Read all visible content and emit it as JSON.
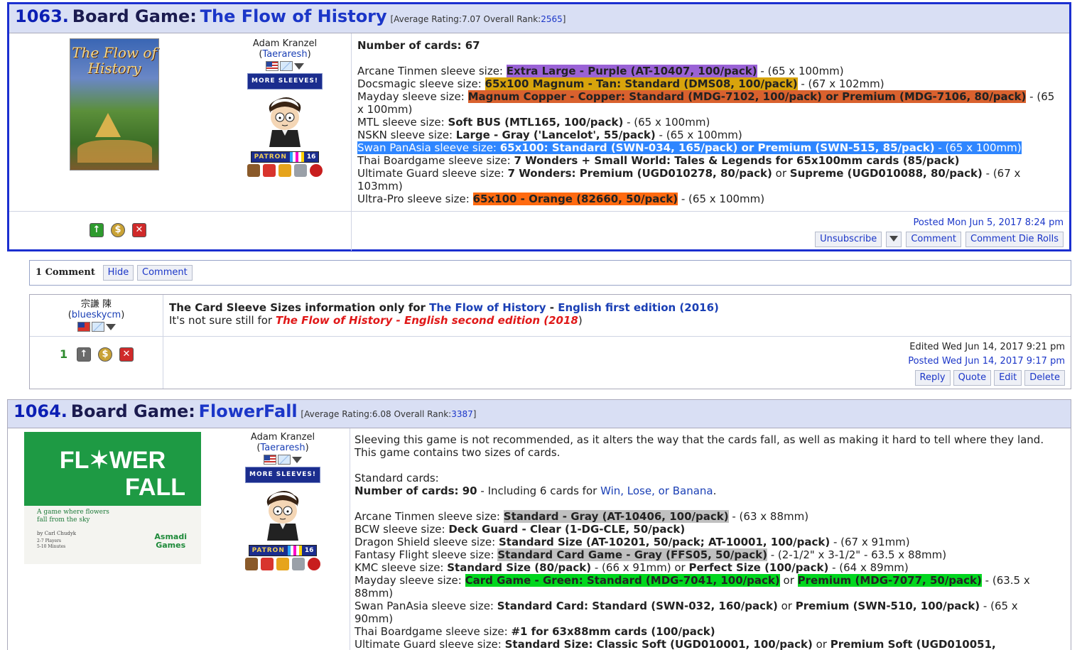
{
  "post1": {
    "number": "1063.",
    "kind": "Board Game:",
    "name": "The Flow of History",
    "meta_prefix": "[Average Rating:7.07 Overall Rank:",
    "rank": "2565",
    "meta_suffix": "]",
    "cover_title": "The Flow of History",
    "user": {
      "name": "Adam Kranzel",
      "handle_open": "(",
      "handle": "Taeraresh",
      "handle_close": ")",
      "more_sleeves": "MORE SLEEVES!",
      "patron": "PATRON",
      "patron_num": "16"
    },
    "lines": [
      {
        "label": "Number of cards: ",
        "value": "67"
      },
      {
        "label": "Arcane Tinmen sleeve size: ",
        "value": "Extra Large - Purple (AT-10407, 100/pack)",
        "after": " - (65 x 100mm)",
        "hl": "purple"
      },
      {
        "label": "Docsmagic sleeve size: ",
        "value": "65x100 Magnum - Tan: Standard (DMS08, 100/pack)",
        "after": " - (67 x 102mm)",
        "hl": "gold"
      },
      {
        "label": "Mayday sleeve size: ",
        "value": "Magnum Copper - Copper: Standard (MDG-7102, 100/pack) or Premium (MDG-7106, 80/pack)",
        "after": " - (65",
        "hl": "copper"
      },
      {
        "label": "",
        "value": "",
        "after": "x 100mm)"
      },
      {
        "label": "MTL sleeve size: ",
        "value": "Soft BUS (MTL165, 100/pack)",
        "after": " - (65 x 100mm)"
      },
      {
        "label": "NSKN sleeve size: ",
        "value": "Large - Gray ('Lancelot', 55/pack)",
        "after": " - (65 x 100mm)"
      },
      {
        "label": "Swan PanAsia sleeve size: ",
        "value": "65x100: Standard (SWN-034, 165/pack) or Premium (SWN-515, 85/pack)",
        "after": " - (65 x 100mm)",
        "hl": "blue"
      },
      {
        "label": "Thai Boardgame sleeve size: ",
        "value": "7 Wonders + Small World: Tales & Legends for 65x100mm cards (85/pack)",
        "after": ""
      },
      {
        "label": "Ultimate Guard sleeve size: ",
        "value": "7 Wonders: Premium (UGD010278, 80/pack)",
        "mid": " or ",
        "value2": "Supreme (UGD010088, 80/pack)",
        "after": " - (67 x"
      },
      {
        "label": "",
        "value": "",
        "after": "103mm)"
      },
      {
        "label": "Ultra-Pro sleeve size: ",
        "value": "65x100 - Orange (82660, 50/pack)",
        "after": " - (65 x 100mm)",
        "hl": "orange"
      }
    ],
    "posted": "Posted Mon Jun 5, 2017 8:24 pm",
    "buttons": {
      "unsubscribe": "Unsubscribe",
      "comment": "Comment",
      "die_rolls": "Comment Die Rolls"
    }
  },
  "comments_bar": {
    "count": "1 Comment",
    "hide": "Hide",
    "comment": "Comment"
  },
  "comment": {
    "user_name": "宗謙 陳",
    "handle_open": "(",
    "handle": "blueskycm",
    "handle_close": ")",
    "score": "1",
    "line1_prefix": "The Card Sleeve Sizes information only for ",
    "line1_link": "The Flow of History",
    "line1_sep": " - ",
    "line1_edition": "English first edition (2016)",
    "line2_prefix": "It's not sure still for ",
    "line2_red": "The Flow of History - English second edition (2018",
    "line2_suffix": ")",
    "edited": "Edited Wed Jun 14, 2017 9:21 pm",
    "posted": "Posted Wed Jun 14, 2017 9:17 pm",
    "buttons": {
      "reply": "Reply",
      "quote": "Quote",
      "edit": "Edit",
      "delete": "Delete"
    }
  },
  "post2": {
    "number": "1064.",
    "kind": "Board Game:",
    "name": "FlowerFall",
    "meta_prefix": "[Average Rating:6.08 Overall Rank:",
    "rank": "3387",
    "meta_suffix": "]",
    "cover": {
      "title1": "FL✶WER",
      "title2": "FALL",
      "tagline": "A game where flowers fall from the sky",
      "author": "by Carl Chudyk",
      "players": "2-7 Players",
      "time": "5-10 Minutes",
      "publisher1": "Asmadi",
      "publisher2": "Games"
    },
    "user": {
      "name": "Adam Kranzel",
      "handle_open": "(",
      "handle": "Taeraresh",
      "handle_close": ")",
      "more_sleeves": "MORE SLEEVES!",
      "patron": "PATRON",
      "patron_num": "16"
    },
    "intro1": "Sleeving this game is not recommended, as it alters the way that the cards fall, as well as making it hard to tell where they land.",
    "intro2": "This game contains two sizes of cards.",
    "standard": "Standard cards:",
    "count_label": "Number of cards: 90",
    "count_after": " - Including 6 cards for ",
    "count_link": "Win, Lose, or Banana",
    "count_end": ".",
    "lines": [
      {
        "label": "Arcane Tinmen sleeve size: ",
        "value": "Standard - Gray (AT-10406, 100/pack)",
        "after": " - (63 x 88mm)",
        "hl": "gray"
      },
      {
        "label": "BCW sleeve size: ",
        "value": "Deck Guard - Clear (1-DG-CLE, 50/pack)",
        "after": ""
      },
      {
        "label": "Dragon Shield sleeve size: ",
        "value": "Standard Size (AT-10201, 50/pack; AT-10001, 100/pack)",
        "after": " - (67 x 91mm)"
      },
      {
        "label": "Fantasy Flight sleeve size: ",
        "value": "Standard Card Game - Gray (FFS05, 50/pack)",
        "after": " - (2-1/2\" x 3-1/2\" - 63.5 x 88mm)",
        "hl": "gray"
      },
      {
        "label": "KMC sleeve size: ",
        "value": "Standard Size (80/pack)",
        "mid": " - (66 x 91mm) or ",
        "value2": "Perfect Size (100/pack)",
        "after": " - (64 x 89mm)"
      },
      {
        "label": "Mayday sleeve size: ",
        "value": "Card Game - Green: Standard (MDG-7041, 100/pack)",
        "mid": " or ",
        "value2": "Premium (MDG-7077, 50/pack)",
        "after": " - (63.5 x",
        "hl": "green",
        "hl2": "green"
      },
      {
        "label": "",
        "value": "",
        "after": "88mm)"
      },
      {
        "label": "Swan PanAsia sleeve size: ",
        "value": "Standard Card: Standard (SWN-032, 160/pack)",
        "mid": " or ",
        "value2": "Premium (SWN-510, 100/pack)",
        "after": " - (65 x"
      },
      {
        "label": "",
        "value": "",
        "after": "90mm)"
      },
      {
        "label": "Thai Boardgame sleeve size: ",
        "value": "#1 for 63x88mm cards (100/pack)",
        "after": ""
      },
      {
        "label": "Ultimate Guard sleeve size: ",
        "value": "Standard Size: Classic Soft (UGD010001, 100/pack)",
        "mid": " or ",
        "value2": "Premium Soft (UGD010051,",
        "after": ""
      }
    ]
  },
  "colors": {
    "border_blue": "#1b2fd0",
    "header_bg": "#d9dff4",
    "link": "#1b36c8",
    "red": "#e01818"
  }
}
